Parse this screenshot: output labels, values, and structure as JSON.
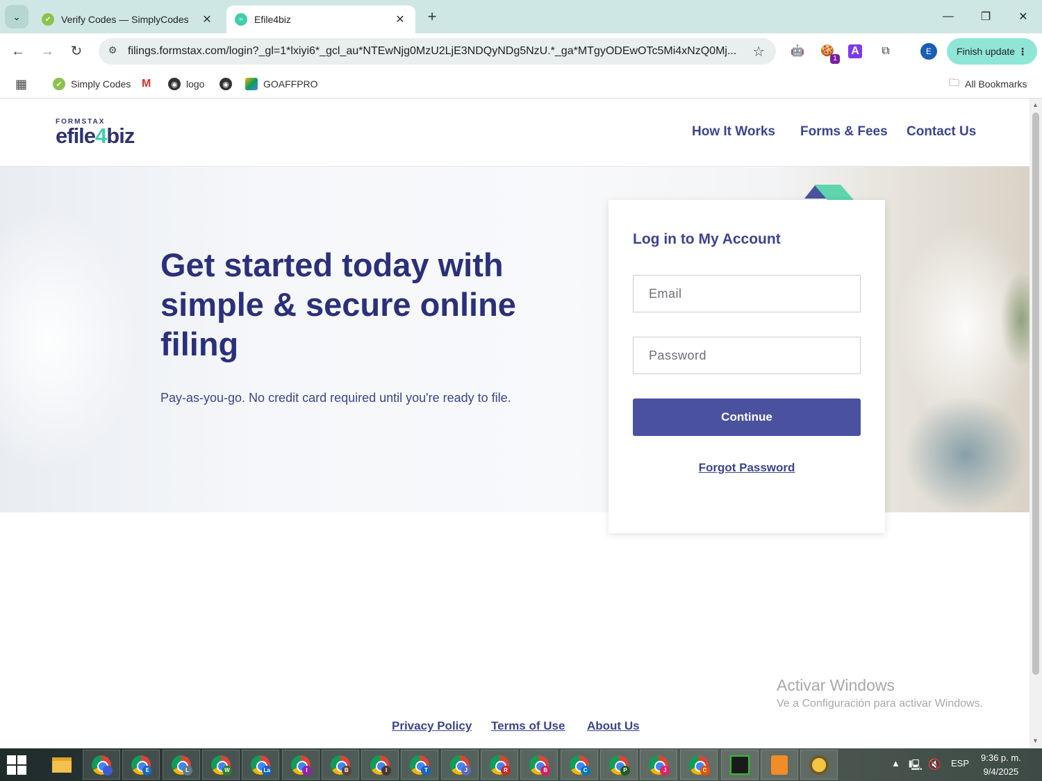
{
  "browser": {
    "tabs": [
      {
        "title": "Verify Codes — SimplyCodes",
        "active": false
      },
      {
        "title": "Efile4biz",
        "active": true
      }
    ],
    "url": "filings.formstax.com/login?_gl=1*lxiyi6*_gcl_au*NTEwNjg0MzU2LjE3NDQyNDg5NzU.*_ga*MTgyODEwOTc5Mi4xNzQ0Mj...",
    "finish_update": "Finish update",
    "profile_initial": "E",
    "extension_badge": "1",
    "bookmarks": [
      "Simply Codes",
      "logo",
      "GOAFFPRO"
    ],
    "all_bookmarks": "All Bookmarks"
  },
  "site": {
    "logo_small": "FORMSTAX",
    "logo_pre": "efile",
    "logo_four": "4",
    "logo_post": "biz",
    "nav": [
      "How It Works",
      "Forms & Fees",
      "Contact Us"
    ],
    "hero_heading": "Get started today with simple & secure online filing",
    "hero_sub": "Pay-as-you-go. No credit card required until you're ready to file.",
    "login": {
      "title": "Log in to My Account",
      "email_placeholder": "Email",
      "password_placeholder": "Password",
      "continue_label": "Continue",
      "forgot_label": "Forgot Password"
    },
    "footer": [
      "Privacy Policy",
      "Terms of Use",
      "About Us"
    ],
    "accent_colors": {
      "navy": "#2b307a",
      "button": "#4a52a0",
      "teal": "#3ecfa9"
    }
  },
  "watermark": {
    "line1": "Activar Windows",
    "line2": "Ve a Configuración para activar Windows."
  },
  "taskbar": {
    "chrome_profiles": [
      "",
      "E",
      "L",
      "W",
      "La",
      "I",
      "B",
      "I",
      "T",
      "J",
      "R",
      "B",
      "C",
      "P",
      "J",
      "C"
    ],
    "language": "ESP",
    "time": "9:36 p. m.",
    "date": "9/4/2025"
  }
}
